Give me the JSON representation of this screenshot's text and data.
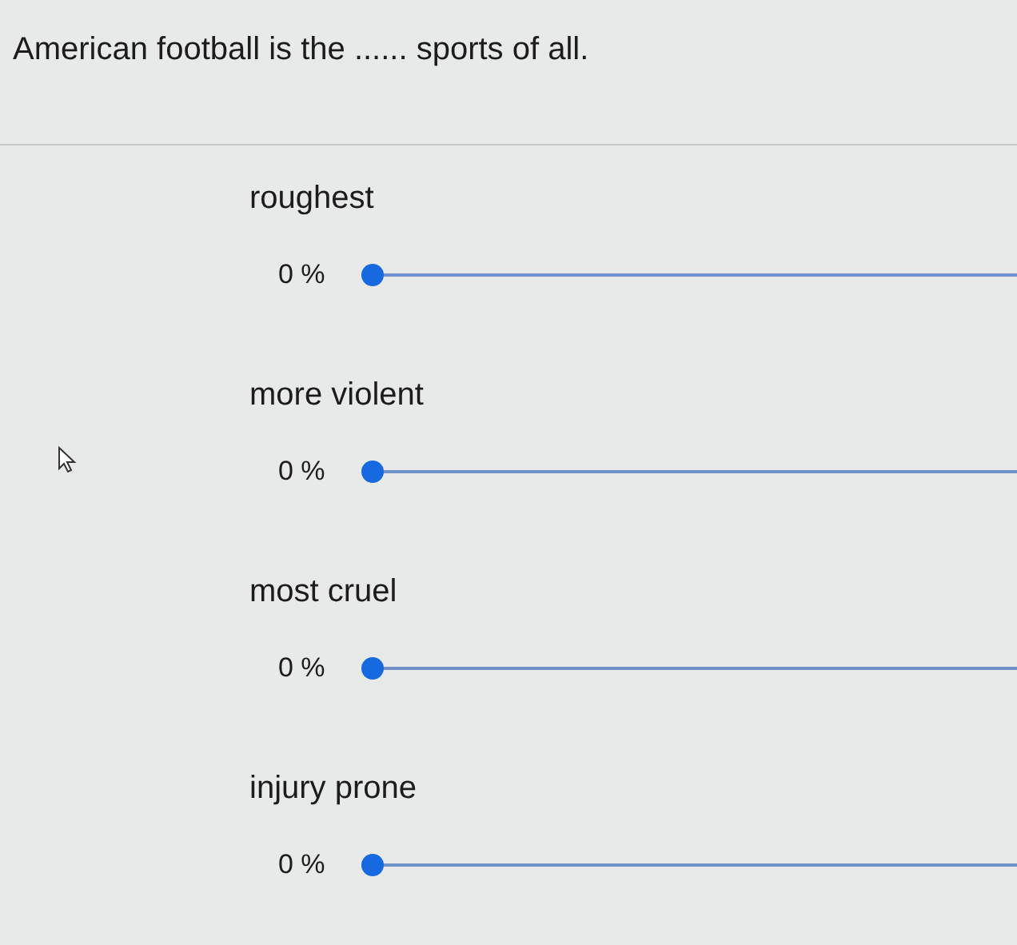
{
  "question": "American football is the ...... sports of all.",
  "options": [
    {
      "label": "roughest",
      "reading": "0 %",
      "level": 0
    },
    {
      "label": "more violent",
      "reading": "0 %",
      "level": 0
    },
    {
      "label": "most cruel",
      "reading": "0 %",
      "level": 0
    },
    {
      "label": "injury prone",
      "reading": "0 %",
      "level": 0
    }
  ]
}
